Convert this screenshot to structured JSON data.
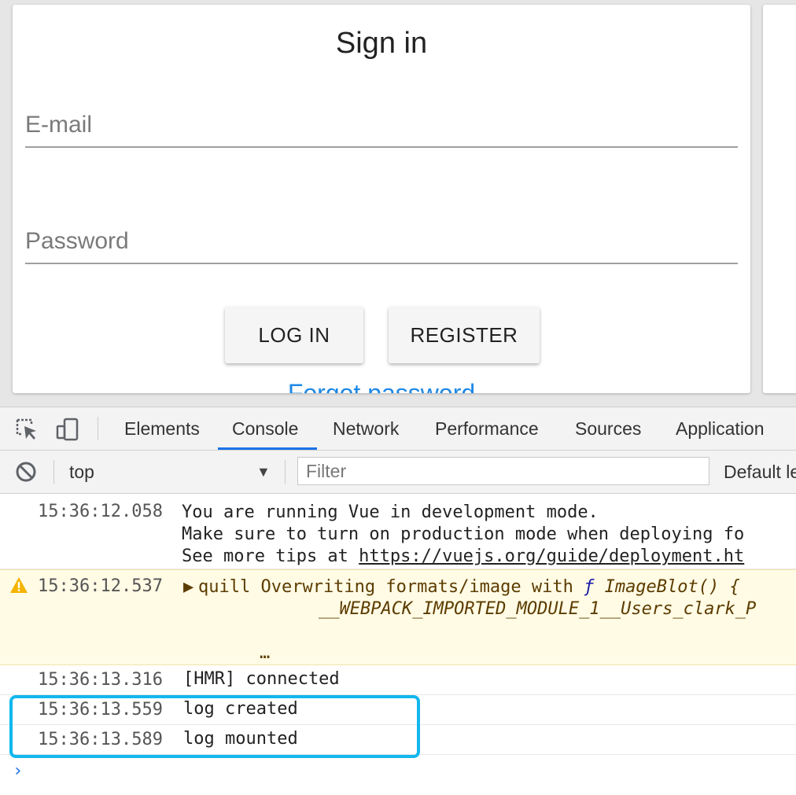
{
  "page": {
    "signin": {
      "title": "Sign in",
      "email_placeholder": "E-mail",
      "password_placeholder": "Password",
      "login_label": "LOG IN",
      "register_label": "REGISTER",
      "forgot_label": "Forgot password"
    }
  },
  "devtools": {
    "tabs": [
      "Elements",
      "Console",
      "Network",
      "Performance",
      "Sources",
      "Application"
    ],
    "active_tab": "Console",
    "context": "top",
    "filter_placeholder": "Filter",
    "levels_label": "Default le",
    "accent_color": "#1a73e8",
    "icons": {
      "inspect": "inspect-element-icon",
      "device": "device-toolbar-icon",
      "clear": "clear-console-icon",
      "dropdown": "dropdown-arrow-icon",
      "warning": "warning-icon",
      "prompt": "console-prompt-icon"
    }
  },
  "console": {
    "messages": [
      {
        "time": "15:36:12.058",
        "lines": [
          "You are running Vue in development mode.",
          "Make sure to turn on production mode when deploying fo",
          "See more tips at "
        ],
        "link": "https://vuejs.org/guide/deployment.ht"
      },
      {
        "time": "15:36:12.537",
        "level": "warning",
        "line1_prefix": "quill Overwriting formats/image with ",
        "line1_fn": "ƒ",
        "line1_rest": " ImageBlot() {",
        "line2": "__WEBPACK_IMPORTED_MODULE_1__Users_clark_P",
        "ellipsis": "…"
      },
      {
        "time": "15:36:13.316",
        "text": "[HMR] connected"
      },
      {
        "time": "15:36:13.559",
        "text": "log created"
      },
      {
        "time": "15:36:13.589",
        "text": "log mounted"
      }
    ],
    "highlight_color": "#12b7ee"
  }
}
